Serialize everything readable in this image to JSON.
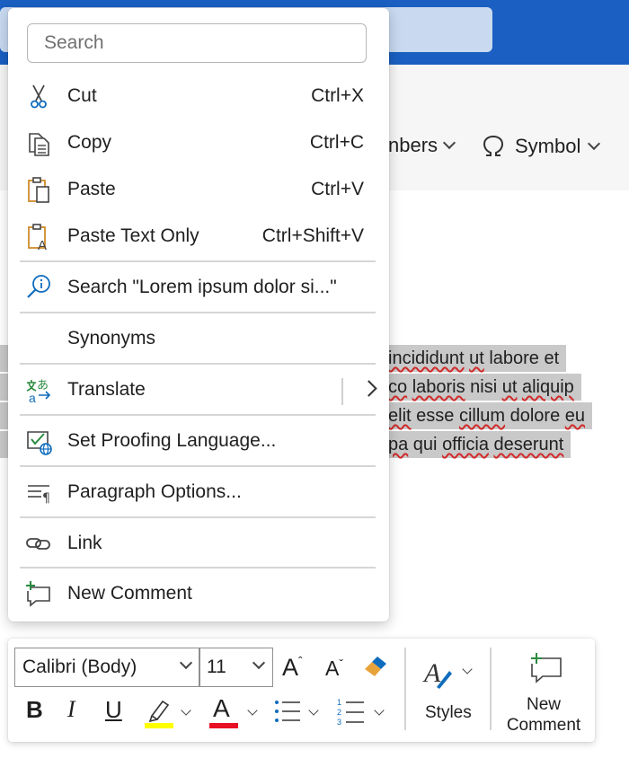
{
  "app": {
    "ribbon": {
      "numbers_label": "nbers",
      "symbol_label": "Symbol"
    },
    "document": {
      "lines": [
        {
          "parts": [
            {
              "t": "incididunt",
              "sq": true
            },
            {
              "t": " "
            },
            {
              "t": "ut",
              "sq": true
            },
            {
              "t": " labore et"
            }
          ]
        },
        {
          "parts": [
            {
              "t": "co",
              "sq": true
            },
            {
              "t": " "
            },
            {
              "t": "laboris",
              "sq": true
            },
            {
              "t": " nisi "
            },
            {
              "t": "ut",
              "sq": true
            },
            {
              "t": " "
            },
            {
              "t": "aliquip",
              "sq": true
            }
          ]
        },
        {
          "parts": [
            {
              "t": "elit",
              "sq": true
            },
            {
              "t": " esse "
            },
            {
              "t": "cillum",
              "sq": true
            },
            {
              "t": " dolore "
            },
            {
              "t": "eu",
              "sq": true
            }
          ]
        },
        {
          "parts": [
            {
              "t": "pa",
              "sq": true
            },
            {
              "t": " qui "
            },
            {
              "t": "officia",
              "sq": true
            },
            {
              "t": " "
            },
            {
              "t": "deserunt",
              "sq": true
            }
          ]
        }
      ]
    }
  },
  "context_menu": {
    "search": {
      "placeholder": "Search"
    },
    "items": [
      {
        "label": "Cut",
        "shortcut": "Ctrl+X",
        "icon": "scissors-icon"
      },
      {
        "label": "Copy",
        "shortcut": "Ctrl+C",
        "icon": "copy-icon"
      },
      {
        "label": "Paste",
        "shortcut": "Ctrl+V",
        "icon": "paste-icon"
      },
      {
        "label": "Paste Text Only",
        "shortcut": "Ctrl+Shift+V",
        "icon": "paste-text-only-icon"
      },
      {
        "label": "Search \"Lorem ipsum dolor si...\"",
        "icon": "smart-lookup-icon"
      },
      {
        "label": "Synonyms"
      },
      {
        "label": "Translate",
        "icon": "translate-icon",
        "has_submenu": true
      },
      {
        "label": "Set Proofing Language...",
        "icon": "proofing-language-icon"
      },
      {
        "label": "Paragraph Options...",
        "icon": "paragraph-icon"
      },
      {
        "label": "Link",
        "icon": "link-icon"
      },
      {
        "label": "New Comment",
        "icon": "new-comment-icon"
      }
    ]
  },
  "mini_toolbar": {
    "font_name": "Calibri (Body)",
    "font_size": "11",
    "grow_font_label": "A",
    "shrink_font_label": "A",
    "bold_label": "B",
    "italic_label": "I",
    "underline_label": "U",
    "font_color_label": "A",
    "styles_label": "Styles",
    "new_comment_label_line1": "New",
    "new_comment_label_line2": "Comment",
    "highlight_color": "#ffff00",
    "font_color": "#e81123"
  },
  "colors": {
    "titlebar": "#1a5fc1",
    "accent_blue": "#0f6cbd",
    "selection_gray": "#c9c9c9"
  }
}
